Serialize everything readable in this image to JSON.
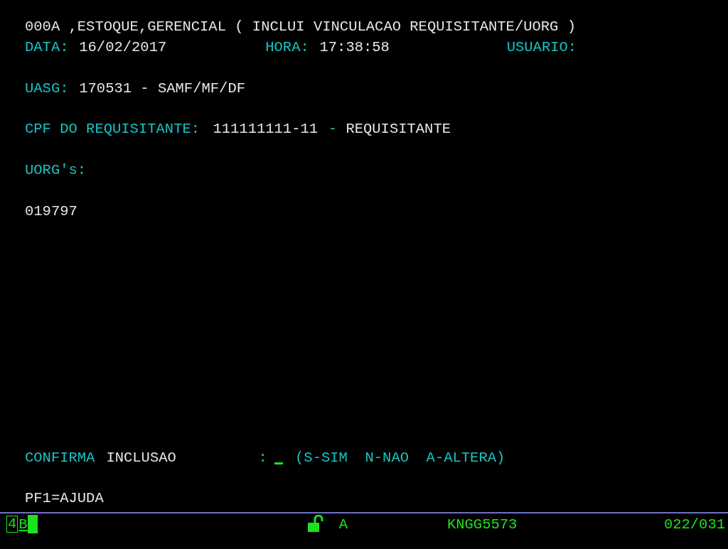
{
  "screen": {
    "lines": [
      [
        {
          "kind": "value",
          "text": "000A ,ESTOQUE,GERENCIAL ( INCLUI VINCULACAO REQUISITANTE/UORG )"
        }
      ],
      [
        {
          "kind": "label",
          "text": "DATA:"
        },
        {
          "kind": "value",
          "text": "16/02/2017"
        },
        {
          "kind": "label",
          "text": "HORA:"
        },
        {
          "kind": "value",
          "text": "17:38:58"
        },
        {
          "kind": "label",
          "text": "USUARIO:"
        }
      ],
      [
        {
          "kind": "label",
          "text": "UASG:"
        },
        {
          "kind": "value",
          "text": "170531 - SAMF/MF/DF"
        }
      ],
      [
        {
          "kind": "label",
          "text": "CPF DO REQUISITANTE:"
        },
        {
          "kind": "value",
          "text": "111111111-11"
        },
        {
          "kind": "label",
          "text": "-"
        },
        {
          "kind": "value",
          "text": "REQUISITANTE"
        }
      ],
      [
        {
          "kind": "label",
          "text": "UORG's:"
        }
      ],
      [
        {
          "kind": "value",
          "text": "019797"
        }
      ],
      [
        {
          "kind": "label",
          "text": "CONFIRMA"
        },
        {
          "kind": "value",
          "text": "INCLUSAO"
        },
        {
          "kind": "label",
          "text": ":"
        },
        {
          "kind": "field"
        },
        {
          "kind": "label",
          "text": "(S-SIM  N-NAO  A-ALTERA)"
        }
      ],
      [
        {
          "kind": "value",
          "text": "PF1=AJUDA"
        }
      ]
    ]
  },
  "status_bar": {
    "session": "4",
    "session_letter": "B",
    "locked": false,
    "mode": "A",
    "lu_name": "KNGG5573",
    "cursor_position": "022/031"
  }
}
